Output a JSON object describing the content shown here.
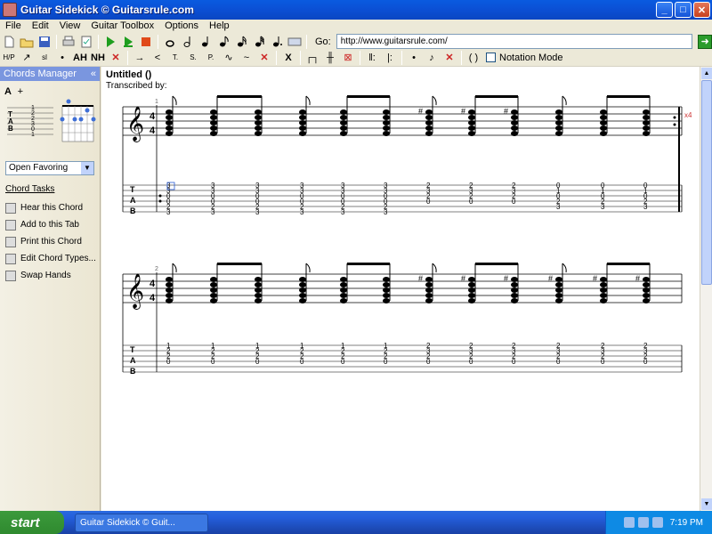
{
  "window": {
    "title": "Guitar Sidekick © Guitarsrule.com"
  },
  "menu": [
    "File",
    "Edit",
    "View",
    "Guitar Toolbox",
    "Options",
    "Help"
  ],
  "toolbar1": {
    "go_label": "Go:",
    "address": "http://www.guitarsrule.com/"
  },
  "toolbar2": {
    "items": [
      "H/P",
      "↗",
      "sl",
      "•",
      "AH",
      "NH",
      "✕",
      "→",
      "<",
      "T.",
      "S.",
      "P.",
      "∿",
      "~",
      "✕",
      "X",
      "┌┐",
      "╫",
      "⊠",
      "‖:",
      "|:",
      "•",
      "♪",
      "✕",
      "( )"
    ],
    "notation_label": "Notation Mode"
  },
  "sidebar": {
    "header": "Chords Manager",
    "chord_name": "A",
    "add_symbol": "+",
    "tab_letters": [
      "T",
      "A",
      "B"
    ],
    "tab_numbers": [
      "1",
      "2",
      "2",
      "3",
      "0",
      "1"
    ],
    "favoring_select": "Open Favoring",
    "tasks_title": "Chord Tasks",
    "tasks": [
      "Hear this Chord",
      "Add to this Tab",
      "Print this Chord",
      "Edit Chord Types...",
      "Swap Hands"
    ]
  },
  "document": {
    "title": "Untitled ()",
    "subtitle": "Transcribed by:",
    "repeat_mark": "x4",
    "measure_numbers": [
      "1",
      "2"
    ],
    "time_signature": [
      "4",
      "4"
    ]
  },
  "system1": {
    "tab_columns": [
      [
        "3",
        "3",
        "0",
        "0",
        "2",
        "3"
      ],
      [
        "3",
        "3",
        "0",
        "0",
        "2",
        "3"
      ],
      [
        "3",
        "3",
        "0",
        "0",
        "2",
        "3"
      ],
      [
        "3",
        "3",
        "0",
        "0",
        "2",
        "3"
      ],
      [
        "3",
        "3",
        "0",
        "0",
        "2",
        "3"
      ],
      [
        "3",
        "3",
        "0",
        "0",
        "2",
        "3"
      ],
      [
        "2",
        "3",
        "2",
        "0",
        "",
        ""
      ],
      [
        "2",
        "3",
        "2",
        "0",
        "",
        ""
      ],
      [
        "2",
        "3",
        "2",
        "0",
        "",
        ""
      ],
      [
        "0",
        "1",
        "0",
        "2",
        "3",
        ""
      ],
      [
        "0",
        "1",
        "0",
        "2",
        "3",
        ""
      ],
      [
        "0",
        "1",
        "0",
        "2",
        "3",
        ""
      ]
    ]
  },
  "system2": {
    "tab_columns": [
      [
        "1",
        "2",
        "2",
        "0",
        "",
        ""
      ],
      [
        "1",
        "2",
        "2",
        "0",
        "",
        ""
      ],
      [
        "1",
        "2",
        "2",
        "0",
        "",
        ""
      ],
      [
        "1",
        "2",
        "2",
        "0",
        "",
        ""
      ],
      [
        "1",
        "2",
        "2",
        "0",
        "",
        ""
      ],
      [
        "1",
        "2",
        "2",
        "0",
        "",
        ""
      ],
      [
        "2",
        "3",
        "2",
        "0",
        "",
        ""
      ],
      [
        "2",
        "3",
        "2",
        "0",
        "",
        ""
      ],
      [
        "2",
        "3",
        "2",
        "0",
        "",
        ""
      ],
      [
        "2",
        "3",
        "2",
        "0",
        "",
        ""
      ],
      [
        "2",
        "3",
        "2",
        "0",
        "",
        ""
      ],
      [
        "2",
        "3",
        "2",
        "0",
        "",
        ""
      ]
    ]
  },
  "taskbar": {
    "start": "start",
    "task_label": "Guitar Sidekick © Guit...",
    "clock": "7:19 PM"
  },
  "colors": {
    "titlebar": "#0a5be0",
    "sidebar_header": "#7a96df",
    "desktop": "#3a6ea5"
  }
}
